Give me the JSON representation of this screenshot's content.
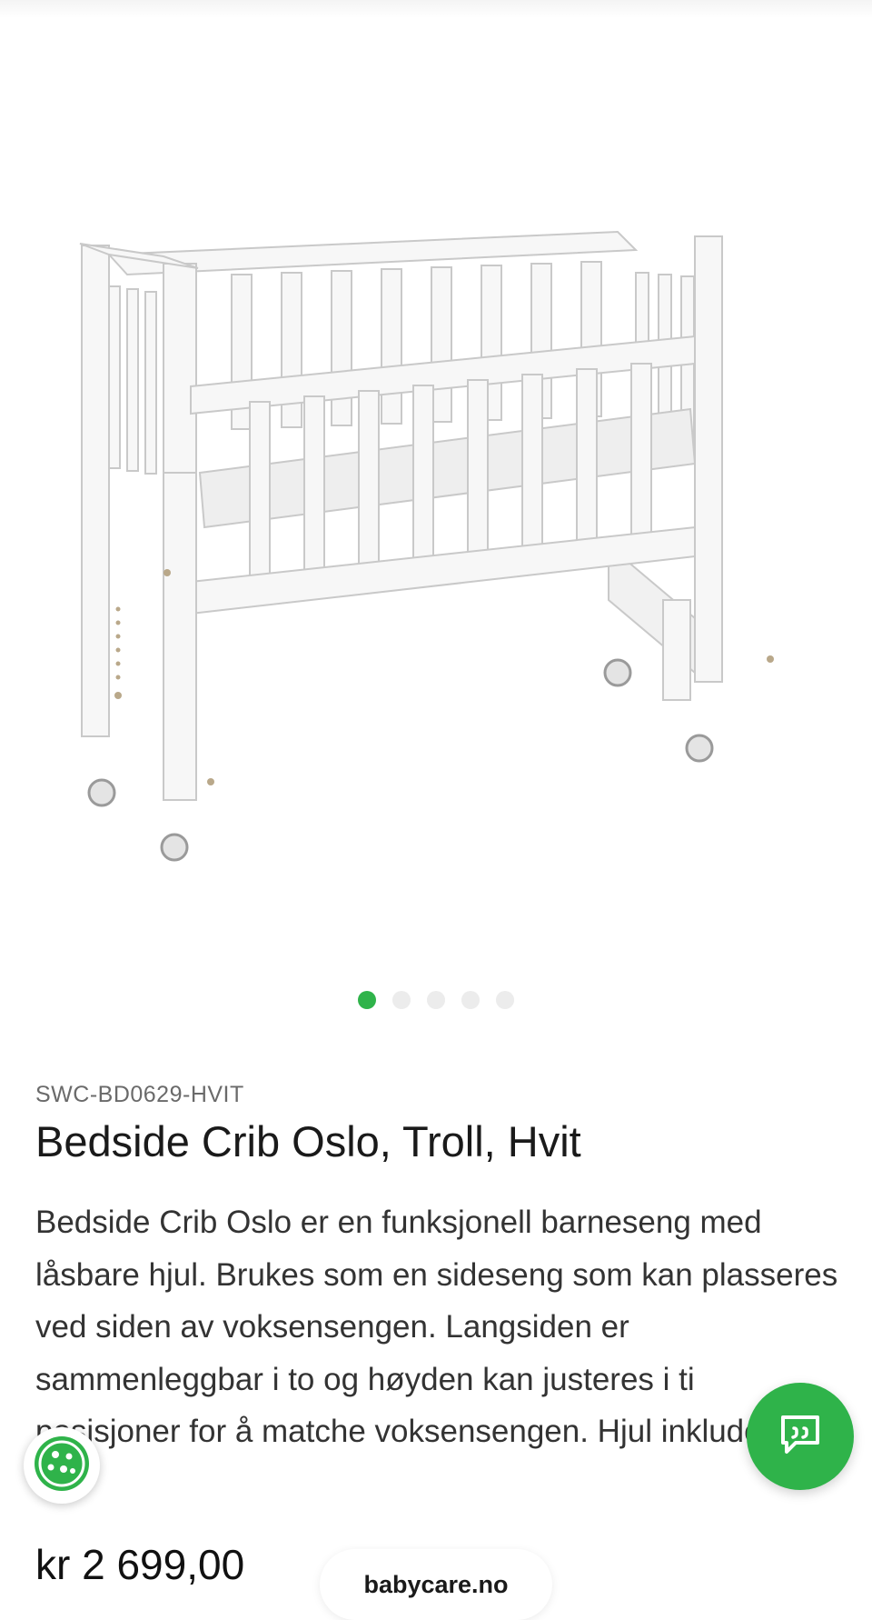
{
  "product": {
    "sku": "SWC-BD0629-HVIT",
    "title": "Bedside Crib Oslo, Troll, Hvit",
    "description": "Bedside Crib Oslo er en funksjonell barneseng med låsbare hjul. Brukes som en sideseng som kan plasseres ved siden av voksensengen. Langsiden er sammenleggbar i to og høyden kan justeres i ti posisjoner for å matche voksensengen. Hjul inkludert.",
    "price": "kr 2 699,00"
  },
  "gallery": {
    "image_alt": "Bedside Crib Oslo, Troll, Hvit",
    "slide_count": 5,
    "active_slide": 1
  },
  "site": {
    "domain": "babycare.no"
  },
  "colors": {
    "accent": "#2fb34a",
    "inactive_dot": "#ececec"
  },
  "icons": {
    "chat": "chat-bubble-icon",
    "cookie": "cookie-icon"
  }
}
